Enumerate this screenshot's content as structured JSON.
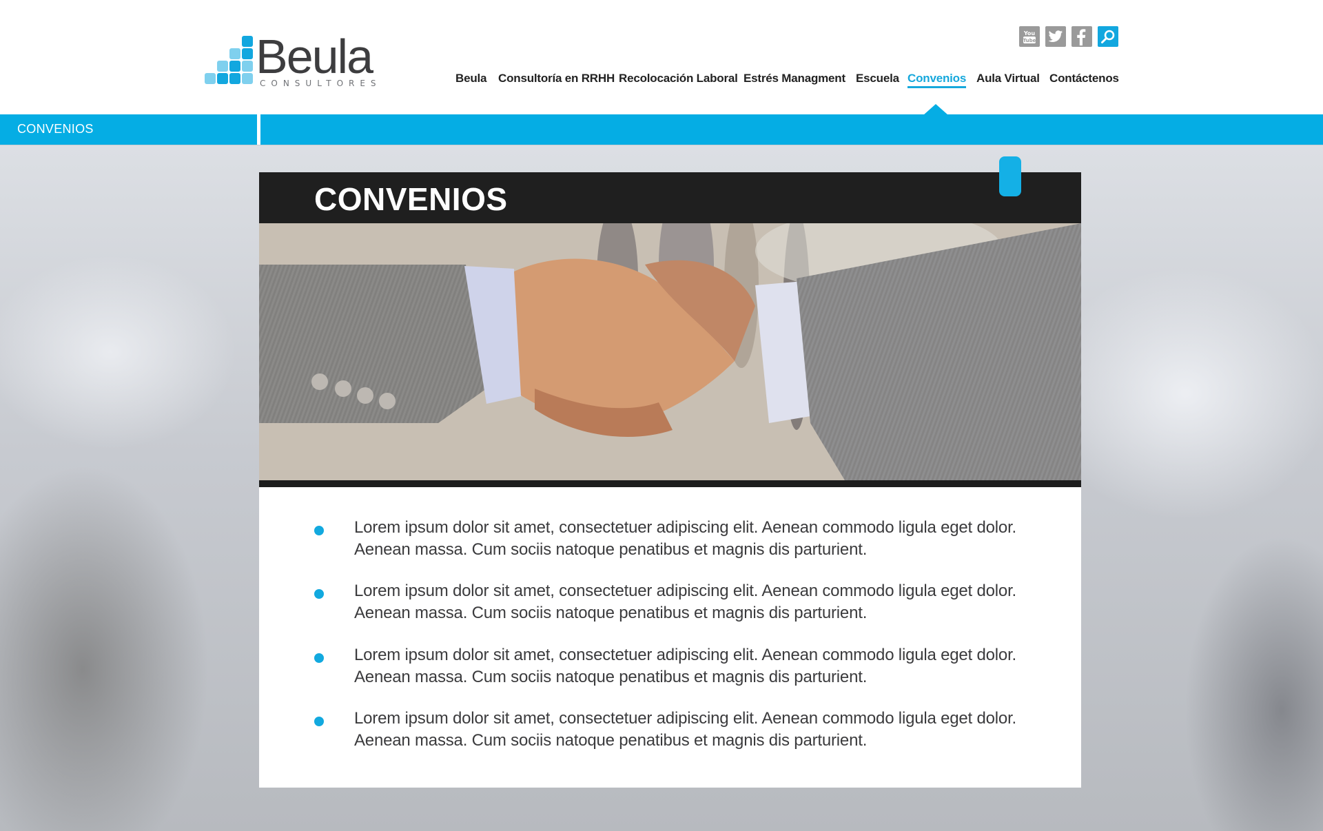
{
  "brand": {
    "name": "Beula",
    "tagline": "CONSULTORES"
  },
  "social": [
    {
      "name": "youtube-icon",
      "label": "You Tube"
    },
    {
      "name": "twitter-icon",
      "label": ""
    },
    {
      "name": "facebook-icon",
      "label": ""
    },
    {
      "name": "search-icon",
      "label": ""
    }
  ],
  "nav": {
    "items": [
      {
        "label": "Beula"
      },
      {
        "label": "Consultoría en RRHH"
      },
      {
        "label": "Recolocación Laboral"
      },
      {
        "label": "Estrés Managment"
      },
      {
        "label": "Escuela"
      },
      {
        "label": "Convenios"
      },
      {
        "label": "Aula Virtual"
      },
      {
        "label": "Contáctenos"
      }
    ],
    "active": "Convenios"
  },
  "section_bar": {
    "label": "CONVENIOS"
  },
  "card": {
    "title": "CONVENIOS",
    "bullets": [
      "Lorem ipsum dolor sit amet, consectetuer adipiscing elit. Aenean commodo ligula eget dolor. Aenean massa. Cum sociis natoque penatibus et magnis dis parturient.",
      "Lorem ipsum dolor sit amet, consectetuer adipiscing elit. Aenean commodo ligula eget dolor. Aenean massa. Cum sociis natoque penatibus et magnis dis parturient.",
      "Lorem ipsum dolor sit amet, consectetuer adipiscing elit. Aenean commodo ligula eget dolor. Aenean massa. Cum sociis natoque penatibus et magnis dis parturient.",
      "Lorem ipsum dolor sit amet, consectetuer adipiscing elit. Aenean commodo ligula eget dolor. Aenean massa. Cum sociis natoque penatibus et magnis dis parturient."
    ]
  },
  "colors": {
    "accent": "#05ade4",
    "text": "#3b3b3d",
    "header_dark": "#1f1f1f",
    "social_gray": "#9a9a9a"
  }
}
